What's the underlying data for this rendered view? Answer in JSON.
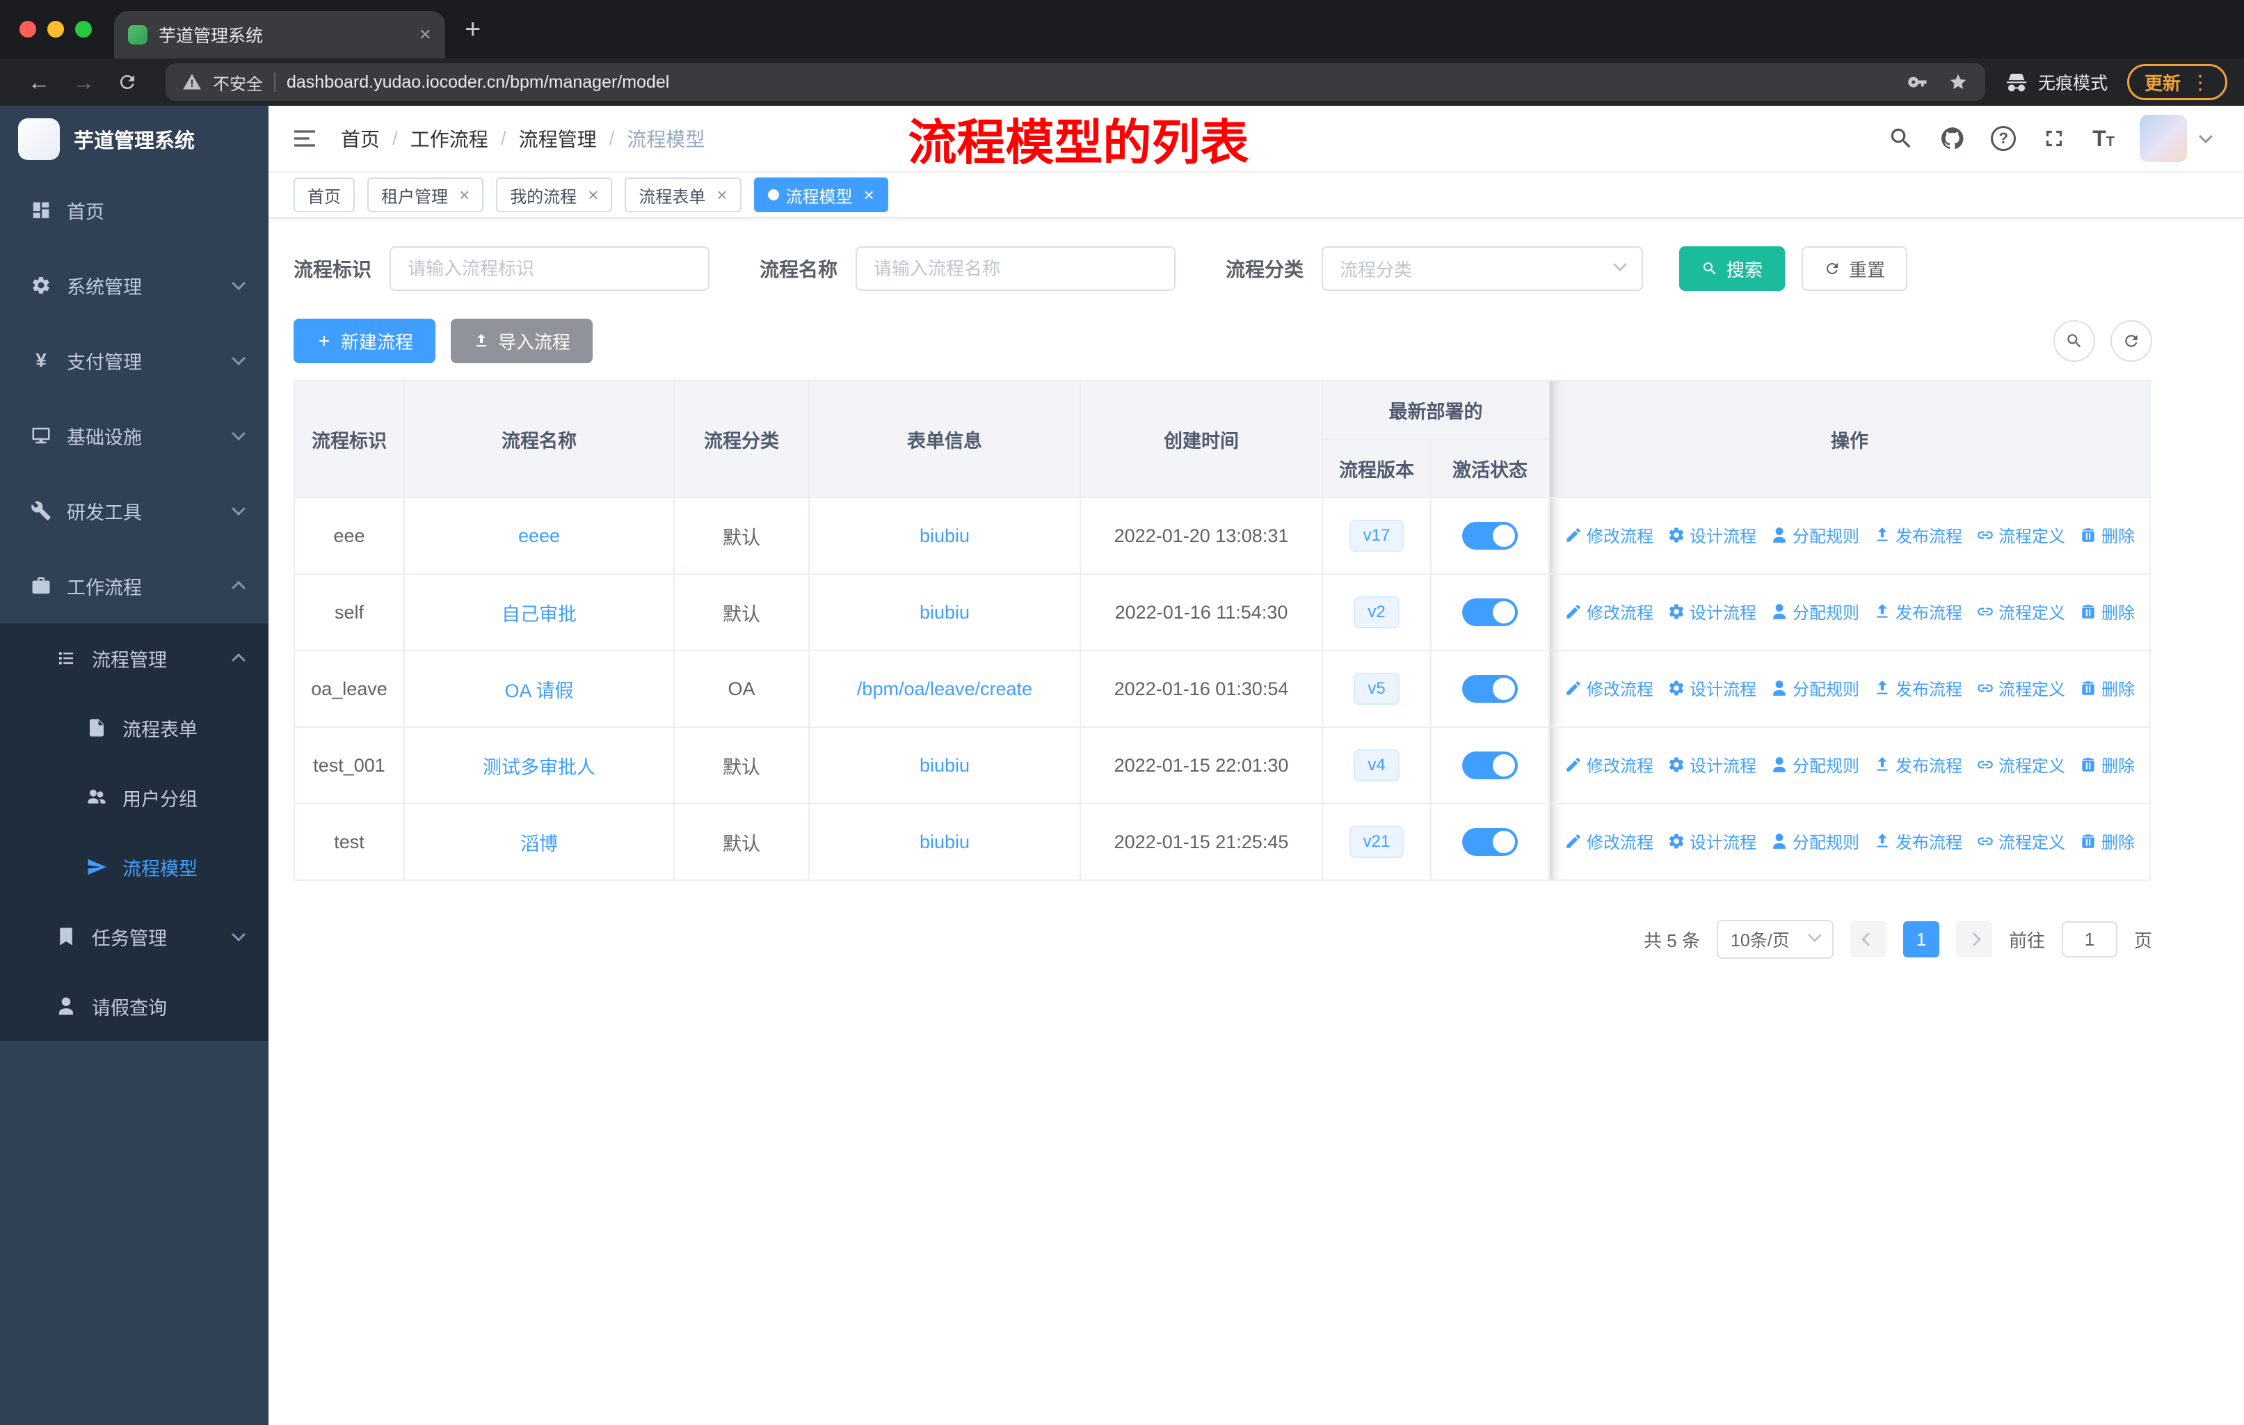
{
  "colors": {
    "accent": "#409eff",
    "teal": "#1abc9c",
    "info": "#909399",
    "red": "#ff0000",
    "sidebar": "#304156",
    "submenu": "#1f2d3d",
    "update": "#f0a13a"
  },
  "glyphs": {
    "back": "←",
    "forward": "→",
    "close": "×",
    "new_tab": "+",
    "menu_dots": "⋮",
    "question": "?",
    "yen": "¥",
    "separator": "/",
    "font_icon_large": "T",
    "font_icon_small": "T"
  },
  "browser": {
    "tab_title": "芋道管理系统",
    "security_label": "不安全",
    "url": "dashboard.yudao.iocoder.cn/bpm/manager/model",
    "incognito_label": "无痕模式",
    "update_label": "更新"
  },
  "sidebar": {
    "logo_title": "芋道管理系统",
    "items": [
      {
        "label": "首页"
      },
      {
        "label": "系统管理"
      },
      {
        "label": "支付管理"
      },
      {
        "label": "基础设施"
      },
      {
        "label": "研发工具"
      },
      {
        "label": "工作流程"
      },
      {
        "label": "流程管理"
      },
      {
        "label": "流程表单"
      },
      {
        "label": "用户分组"
      },
      {
        "label": "流程模型"
      },
      {
        "label": "任务管理"
      },
      {
        "label": "请假查询"
      }
    ]
  },
  "header": {
    "breadcrumb": [
      "首页",
      "工作流程",
      "流程管理",
      "流程模型"
    ],
    "annotation": "流程模型的列表"
  },
  "tags": {
    "items": [
      "首页",
      "租户管理",
      "我的流程",
      "流程表单",
      "流程模型"
    ]
  },
  "filters": {
    "key_label": "流程标识",
    "key_placeholder": "请输入流程标识",
    "name_label": "流程名称",
    "name_placeholder": "请输入流程名称",
    "category_label": "流程分类",
    "category_placeholder": "流程分类",
    "search_label": "搜索",
    "reset_label": "重置"
  },
  "toolbar": {
    "create_label": "新建流程",
    "import_label": "导入流程"
  },
  "table": {
    "headers": {
      "key": "流程标识",
      "name": "流程名称",
      "category": "流程分类",
      "form": "表单信息",
      "created": "创建时间",
      "deploy_group": "最新部署的",
      "version": "流程版本",
      "active": "激活状态",
      "actions": "操作"
    },
    "ops": [
      {
        "name": "edit-flow",
        "icon": "edit",
        "label": "修改流程"
      },
      {
        "name": "design-flow",
        "icon": "gear",
        "label": "设计流程"
      },
      {
        "name": "assign-rule",
        "icon": "user",
        "label": "分配规则"
      },
      {
        "name": "publish-flow",
        "icon": "publish",
        "label": "发布流程"
      },
      {
        "name": "flow-definition",
        "icon": "link",
        "label": "流程定义"
      },
      {
        "name": "delete-flow",
        "icon": "trash",
        "label": "删除"
      }
    ],
    "rows": [
      {
        "key": "eee",
        "name": "eeee",
        "category": "默认",
        "form": "biubiu",
        "created": "2022-01-20 13:08:31",
        "version": "v17"
      },
      {
        "key": "self",
        "name": "自己审批",
        "category": "默认",
        "form": "biubiu",
        "created": "2022-01-16 11:54:30",
        "version": "v2"
      },
      {
        "key": "oa_leave",
        "name": "OA 请假",
        "category": "OA",
        "form": "/bpm/oa/leave/create",
        "created": "2022-01-16 01:30:54",
        "version": "v5"
      },
      {
        "key": "test_001",
        "name": "测试多审批人",
        "category": "默认",
        "form": "biubiu",
        "created": "2022-01-15 22:01:30",
        "version": "v4"
      },
      {
        "key": "test",
        "name": "滔博",
        "category": "默认",
        "form": "biubiu",
        "created": "2022-01-15 21:25:45",
        "version": "v21"
      }
    ]
  },
  "pagination": {
    "total": "共 5 条",
    "page_size": "10条/页",
    "current_page": "1",
    "goto_label": "前往",
    "goto_value": "1",
    "page_unit": "页"
  }
}
